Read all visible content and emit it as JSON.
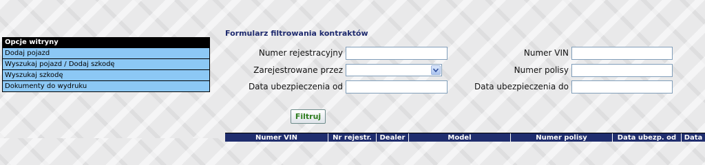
{
  "sidebar": {
    "title": "Opcje witryny",
    "items": [
      {
        "label": "Dodaj pojazd"
      },
      {
        "label": "Wyszukaj pojazd / Dodaj szkodę"
      },
      {
        "label": "Wyszukaj szkodę"
      },
      {
        "label": "Dokumenty do wydruku"
      }
    ]
  },
  "form": {
    "title": "Formularz filtrowania kontraktów",
    "numer_rejestracyjny": {
      "label": "Numer rejestracyjny",
      "value": ""
    },
    "zarejestrowane_przez": {
      "label": "Zarejestrowane przez",
      "value": ""
    },
    "data_od": {
      "label": "Data ubezpieczenia od",
      "value": ""
    },
    "numer_vin": {
      "label": "Numer VIN",
      "value": ""
    },
    "numer_polisy": {
      "label": "Numer polisy",
      "value": ""
    },
    "data_do": {
      "label": "Data ubezpieczenia do",
      "value": ""
    },
    "submit_label": "Filtruj"
  },
  "table": {
    "columns": [
      "Numer VIN",
      "Nr rejestr.",
      "Dealer",
      "Model",
      "Numer polisy",
      "Data ubezp. od",
      "Data"
    ]
  },
  "colors": {
    "sidebar_item_bg": "#8cc8f5",
    "title_color": "#1e2a6e",
    "button_text": "#2e7d1e",
    "table_header_bg": "#1f2d6e"
  }
}
